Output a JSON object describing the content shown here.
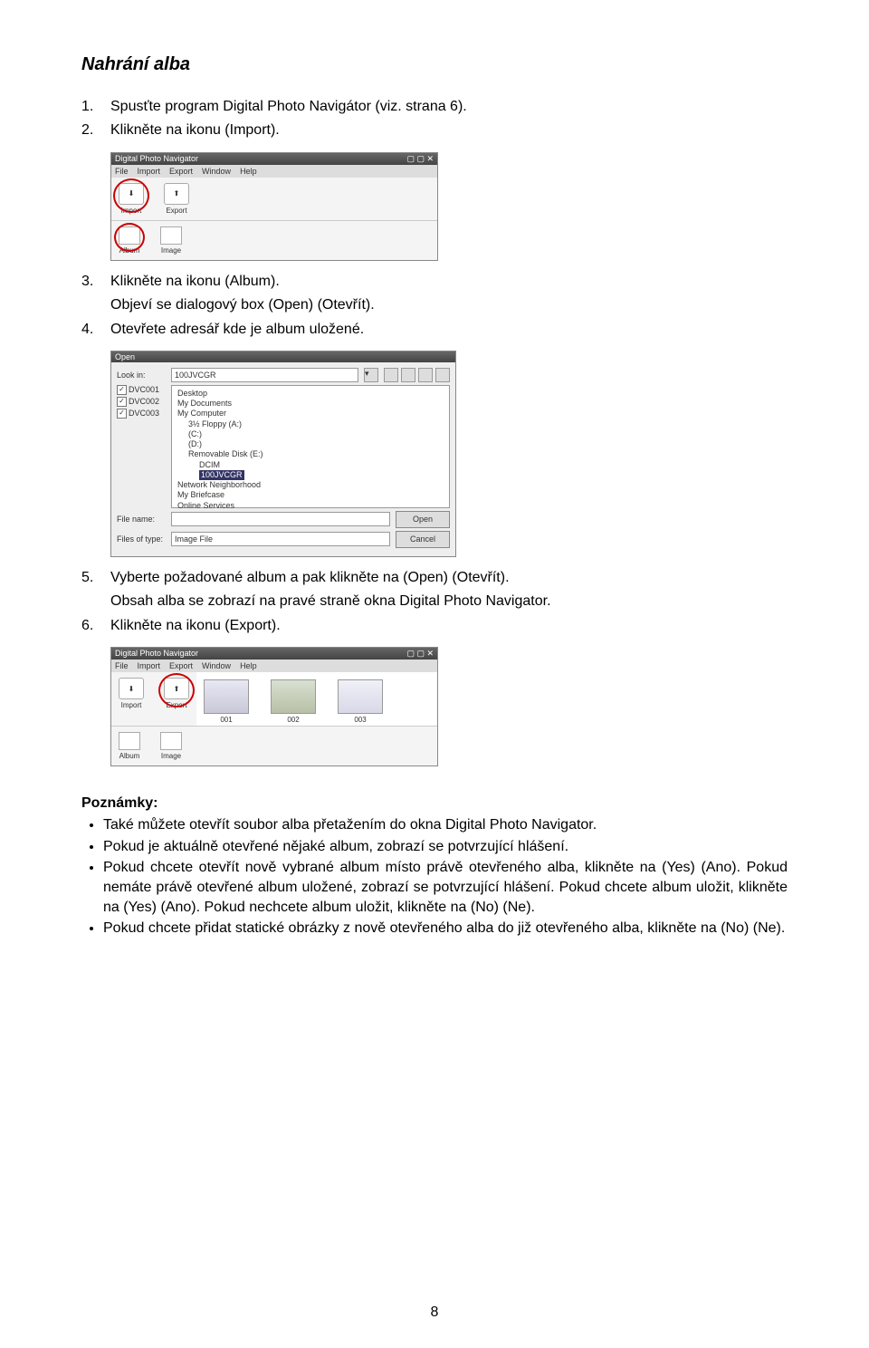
{
  "title": "Nahrání alba",
  "steps": {
    "s1": {
      "num": "1.",
      "text": "Spusťte program Digital Photo Navigátor (viz. strana 6)."
    },
    "s2": {
      "num": "2.",
      "text": "Klikněte na ikonu (Import)."
    },
    "s3": {
      "num": "3.",
      "text": "Klikněte na ikonu (Album)."
    },
    "s3b": "Objeví se dialogový box (Open) (Otevřít).",
    "s4": {
      "num": "4.",
      "text": "Otevřete adresář kde je album uložené."
    },
    "s5": {
      "num": "5.",
      "text": "Vyberte požadované album a pak klikněte na (Open) (Otevřít)."
    },
    "s5b": "Obsah alba se zobrazí na pravé straně okna Digital Photo Navigator.",
    "s6": {
      "num": "6.",
      "text": "Klikněte na ikonu (Export)."
    }
  },
  "app1": {
    "title": "Digital Photo Navigator",
    "menu": [
      "File",
      "Import",
      "Export",
      "Window",
      "Help"
    ],
    "toolbar": [
      {
        "label": "Import",
        "highlight": true
      },
      {
        "label": "Export",
        "highlight": false
      }
    ],
    "bottombar": [
      {
        "label": "Album",
        "highlight": true
      },
      {
        "label": "Image",
        "highlight": false
      }
    ]
  },
  "dialog": {
    "title": "Open",
    "lookin_label": "Look in:",
    "lookin_value": "100JVCGR",
    "check_items": [
      "DVC001",
      "DVC002",
      "DVC003"
    ],
    "tree": [
      {
        "level": 0,
        "text": "Desktop"
      },
      {
        "level": 0,
        "text": "My Documents"
      },
      {
        "level": 0,
        "text": "My Computer"
      },
      {
        "level": 1,
        "text": "3½ Floppy (A:)"
      },
      {
        "level": 1,
        "text": "(C:)"
      },
      {
        "level": 1,
        "text": "(D:)"
      },
      {
        "level": 1,
        "text": "Removable Disk (E:)"
      },
      {
        "level": 2,
        "text": "DCIM"
      },
      {
        "level": 2,
        "text": "100JVCGR",
        "hl": true
      },
      {
        "level": 0,
        "text": "Network Neighborhood"
      },
      {
        "level": 0,
        "text": "My Briefcase"
      },
      {
        "level": 0,
        "text": "Online Services"
      }
    ],
    "filename_label": "File name:",
    "filename_value": "",
    "filetype_label": "Files of type:",
    "filetype_value": "Image File",
    "open_btn": "Open",
    "cancel_btn": "Cancel"
  },
  "app2": {
    "title": "Digital Photo Navigator",
    "menu": [
      "File",
      "Import",
      "Export",
      "Window",
      "Help"
    ],
    "toolbar": [
      {
        "label": "Import",
        "highlight": false
      },
      {
        "label": "Export",
        "highlight": true
      }
    ],
    "thumbs": [
      "001",
      "002",
      "003"
    ],
    "bottombar": [
      {
        "label": "Album",
        "highlight": false
      },
      {
        "label": "Image",
        "highlight": false
      }
    ]
  },
  "notes_heading": "Poznámky:",
  "notes": [
    "Také můžete otevřít soubor alba přetažením do okna Digital Photo Navigator.",
    "Pokud je aktuálně otevřené nějaké album, zobrazí se potvrzující hlášení.",
    "Pokud chcete otevřít nově vybrané album místo právě otevřeného alba, klikněte na (Yes) (Ano). Pokud nemáte právě otevřené album uložené, zobrazí se potvrzující hlášení. Pokud chcete album uložit, klikněte na (Yes) (Ano). Pokud nechcete album uložit, klikněte na (No) (Ne).",
    "Pokud chcete přidat statické obrázky z nově otevřeného alba do již otevřeného alba, klikněte na (No) (Ne)."
  ],
  "page_number": "8"
}
